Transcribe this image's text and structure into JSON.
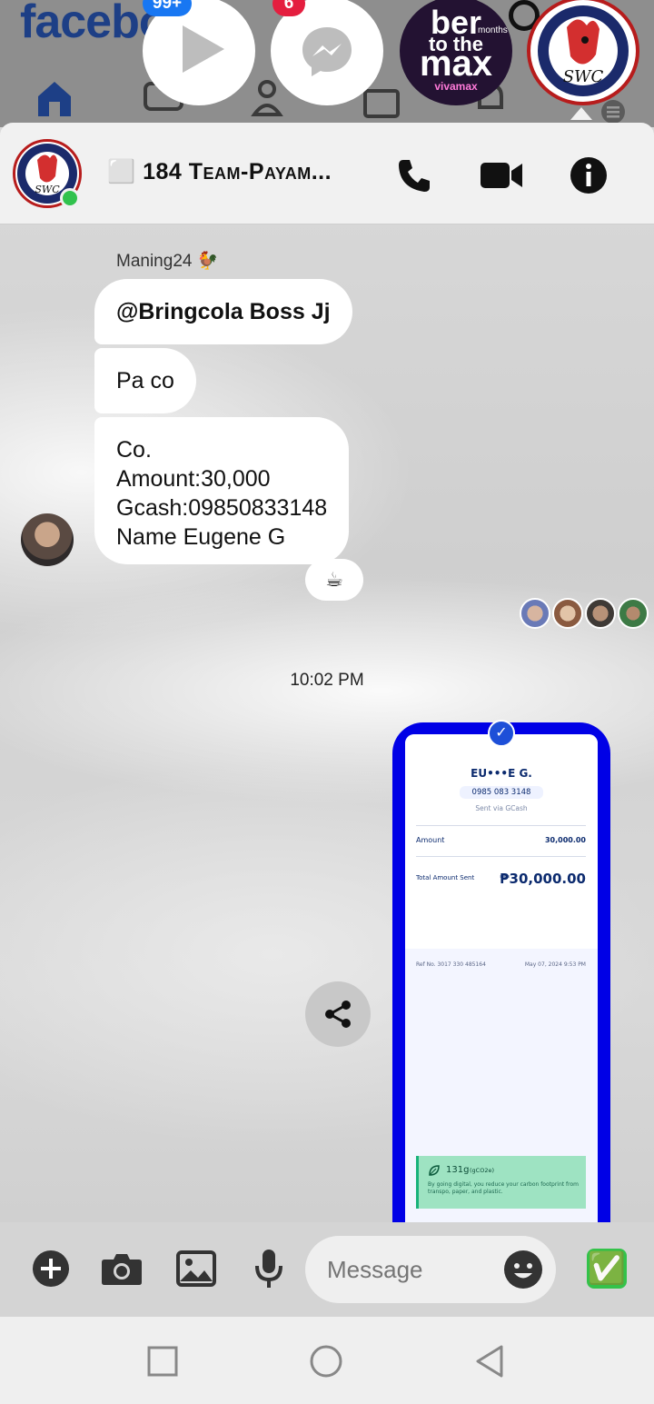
{
  "background_app": {
    "logo_text": "facebook",
    "nav_icons": [
      "home-icon",
      "video-icon",
      "friends-icon",
      "marketplace-icon",
      "bell-icon",
      "menu-icon"
    ]
  },
  "chat_heads": [
    {
      "name": "video-chat-head",
      "badge": "99+",
      "badge_color": "#1877f2"
    },
    {
      "name": "messenger-chat-head",
      "badge": "6",
      "badge_color": "#e41e3f"
    },
    {
      "name": "vivamax-chat-head",
      "line1": "ber",
      "line2": "to the",
      "line3": "max",
      "small": "months",
      "brand": "vivamax"
    },
    {
      "name": "team-chat-head",
      "badge": "",
      "badge_color": "#e41e3f"
    }
  ],
  "header": {
    "title": "⬜ 184 Team-Payam...",
    "call_icon": "phone-icon",
    "video_icon": "video-camera-icon",
    "info_icon": "info-icon"
  },
  "messages": {
    "sender_name": "Maning24 🐓",
    "bubbles": [
      "@Bringcola Boss Jj",
      "Pa co"
    ],
    "bubble3_lines": [
      "Co.",
      "Amount:30,000",
      "Gcash:09850833148",
      "Name Eugene G"
    ],
    "reaction": "☕",
    "timestamp": "10:02 PM"
  },
  "receipt": {
    "name": "EU•••E G.",
    "number": "0985 083 3148",
    "sent_via": "Sent via GCash",
    "amount_label": "Amount",
    "amount_value": "30,000.00",
    "total_label": "Total Amount Sent",
    "total_value": "₱30,000.00",
    "ref_label": "Ref No. 3017 330 485164",
    "date": "May 07, 2024 9:53 PM",
    "eco_value": "131g",
    "eco_unit": "(gCO2e)",
    "eco_text": "By going digital, you reduce your carbon footprint from transpo, paper, and plastic."
  },
  "composer": {
    "placeholder": "Message",
    "send_emoji": "✅"
  },
  "colors": {
    "accent_blue": "#0000e6",
    "online_green": "#31c24d",
    "badge_red": "#e41e3f"
  }
}
